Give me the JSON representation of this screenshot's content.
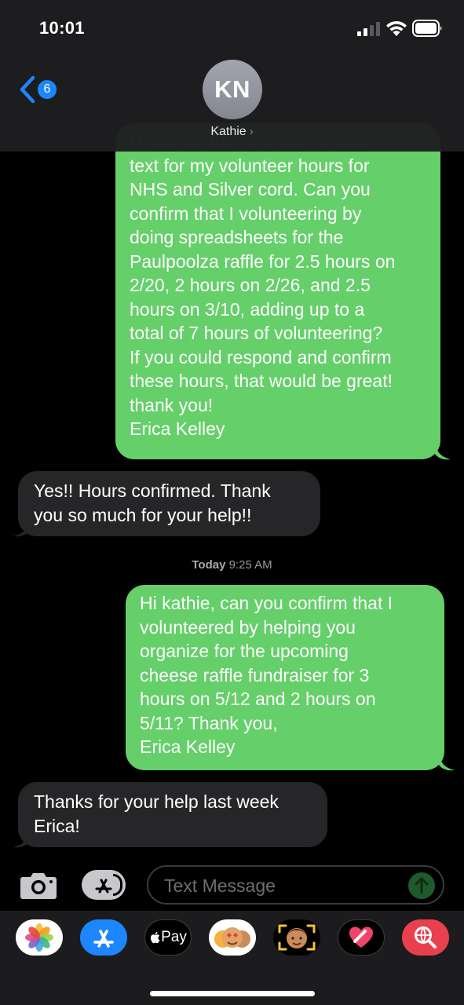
{
  "status_bar": {
    "time": "10:01"
  },
  "header": {
    "back_badge": "6",
    "avatar_initials": "KN",
    "contact_name": "Kathie",
    "contact_chevron": "›"
  },
  "messages": [
    {
      "direction": "outgoing",
      "text": "Hi kathie, this is a confirmation\ntext for my volunteer hours for\nNHS and Silver cord. Can you\nconfirm that I volunteering by\ndoing spreadsheets for the\nPaulpoolza raffle for 2.5 hours on\n2/20, 2 hours on 2/26, and 2.5\nhours on 3/10, adding up to a\ntotal of 7 hours of volunteering?\nIf you could respond and confirm\nthese hours, that would be great!\nthank you!\nErica Kelley"
    },
    {
      "direction": "incoming",
      "text": "Yes!! Hours confirmed. Thank\nyou so much for your help!!"
    },
    {
      "direction": "outgoing",
      "text": "Hi kathie, can you confirm that I\nvolunteered by helping you\norganize for the upcoming\ncheese raffle fundraiser for 3\nhours on 5/12 and 2 hours on\n5/11? Thank you,\nErica Kelley"
    },
    {
      "direction": "incoming",
      "text": "Thanks for your help last week\nErica!"
    }
  ],
  "timestamp": {
    "day": "Today",
    "time": "9:25 AM"
  },
  "composer": {
    "placeholder": "Text Message"
  },
  "app_drawer": [
    {
      "icon": "photos-icon"
    },
    {
      "icon": "app-store-icon"
    },
    {
      "icon": "apple-pay-icon",
      "label": "Pay"
    },
    {
      "icon": "memoji-stickers-icon"
    },
    {
      "icon": "memoji-icon"
    },
    {
      "icon": "digital-touch-icon"
    },
    {
      "icon": "web-search-icon"
    }
  ],
  "colors": {
    "outgoing_bubble": "#65cf6a",
    "incoming_bubble": "#262628",
    "accent_blue": "#1c86ff",
    "background": "#000000"
  }
}
